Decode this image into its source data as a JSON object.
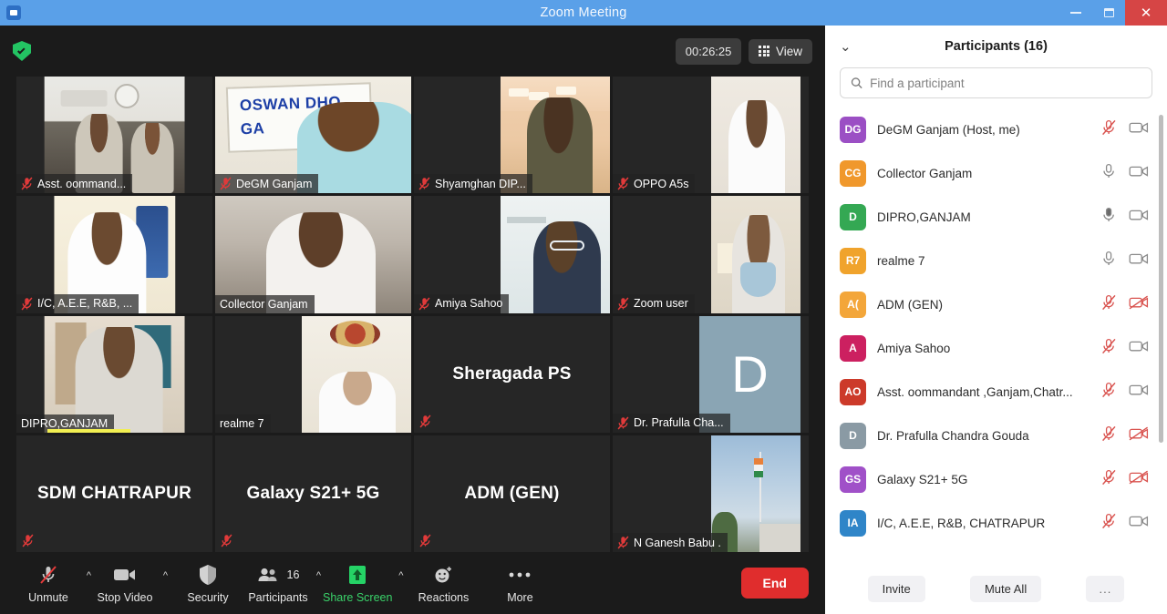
{
  "window": {
    "title": "Zoom Meeting",
    "minimize_label": "Minimize",
    "maximize_label": "Maximize",
    "close_label": "Close"
  },
  "header": {
    "timer": "00:26:25",
    "view_label": "View",
    "encryption_tooltip": "Encryption"
  },
  "tiles": [
    {
      "name": "Asst. oommand...",
      "muted": true,
      "kind": "video",
      "scene": "sc1",
      "frame": "w-center72",
      "label_style": "bar"
    },
    {
      "name": "DeGM Ganjam",
      "muted": true,
      "kind": "video",
      "scene": "sc2",
      "frame": "w-full",
      "label_style": "bar"
    },
    {
      "name": "Shyamghan DIP...",
      "muted": true,
      "kind": "video",
      "scene": "sc3",
      "frame": "w-rightwide",
      "label_style": "bar"
    },
    {
      "name": "OPPO A5s",
      "muted": true,
      "kind": "video",
      "scene": "sc4",
      "frame": "w-right",
      "label_style": "bar"
    },
    {
      "name": "I/C, A.E.E, R&B, ...",
      "muted": true,
      "kind": "video",
      "scene": "sc5",
      "frame": "w-mid",
      "label_style": "bar"
    },
    {
      "name": "Collector Ganjam",
      "muted": false,
      "kind": "video",
      "scene": "sc6",
      "frame": "w-full",
      "label_style": "bar",
      "active_speaker": true
    },
    {
      "name": "Amiya Sahoo",
      "muted": true,
      "kind": "video",
      "scene": "sc7",
      "frame": "w-rightwide",
      "label_style": "bar"
    },
    {
      "name": "Zoom user",
      "muted": true,
      "kind": "video",
      "scene": "sc8",
      "frame": "w-right",
      "label_style": "bar"
    },
    {
      "name": "DIPRO,GANJAM",
      "muted": false,
      "kind": "video",
      "scene": "sc9",
      "frame": "w-center72",
      "label_style": "bar",
      "speaking_bar": true
    },
    {
      "name": "realme 7",
      "muted": false,
      "kind": "video",
      "scene": "sc10",
      "frame": "w-rightwide",
      "label_style": "bar"
    },
    {
      "name": "Sheragada PS",
      "muted": true,
      "kind": "name",
      "label_style": "center"
    },
    {
      "name": "Dr. Prafulla Cha...",
      "muted": true,
      "kind": "avatar",
      "avatar_letter": "D",
      "label_style": "bar"
    },
    {
      "name": "SDM CHATRAPUR",
      "muted": true,
      "kind": "name",
      "label_style": "center"
    },
    {
      "name": "Galaxy S21+ 5G",
      "muted": true,
      "kind": "name",
      "label_style": "center"
    },
    {
      "name": "ADM (GEN)",
      "muted": true,
      "kind": "name",
      "label_style": "center"
    },
    {
      "name": "N Ganesh Babu .",
      "muted": true,
      "kind": "video",
      "scene": "sc11",
      "frame": "w-right",
      "label_style": "bar"
    }
  ],
  "toolbar": {
    "items": [
      {
        "label": "Unmute",
        "icon": "mic-muted-icon",
        "caret": true,
        "accent": false
      },
      {
        "label": "Stop Video",
        "icon": "video-icon",
        "caret": true,
        "accent": false
      },
      {
        "label": "Security",
        "icon": "shield-icon",
        "caret": false,
        "accent": false
      },
      {
        "label": "Participants",
        "icon": "participants-icon",
        "caret": true,
        "accent": false,
        "badge": "16"
      },
      {
        "label": "Share Screen",
        "icon": "share-screen-icon",
        "caret": true,
        "accent": true
      },
      {
        "label": "Reactions",
        "icon": "reactions-icon",
        "caret": false,
        "accent": false
      },
      {
        "label": "More",
        "icon": "more-icon",
        "caret": false,
        "accent": false
      }
    ],
    "end_label": "End"
  },
  "panel": {
    "title": "Participants (16)",
    "search_placeholder": "Find a participant",
    "search_value": "",
    "participants": [
      {
        "initials": "DG",
        "color": "#9b4fc4",
        "name": "DeGM Ganjam  (Host, me)",
        "mic": "muted",
        "video": "on"
      },
      {
        "initials": "CG",
        "color": "#f0982c",
        "name": "Collector Ganjam",
        "mic": "on",
        "video": "on"
      },
      {
        "initials": "D",
        "color": "#34a853",
        "name": "DIPRO,GANJAM",
        "mic": "active",
        "video": "on"
      },
      {
        "initials": "R7",
        "color": "#f0a32c",
        "name": "realme 7",
        "mic": "on",
        "video": "on"
      },
      {
        "initials": "A(",
        "color": "#f3a63a",
        "name": "ADM (GEN)",
        "mic": "muted",
        "video": "off"
      },
      {
        "initials": "A",
        "color": "#cc2060",
        "name": "Amiya Sahoo",
        "mic": "muted",
        "video": "on"
      },
      {
        "initials": "AO",
        "color": "#cc3a2a",
        "name": "Asst. oommandant ,Ganjam,Chatr...",
        "mic": "muted",
        "video": "on"
      },
      {
        "initials": "D",
        "color": "#8a9aa4",
        "name": "Dr. Prafulla Chandra Gouda",
        "mic": "muted",
        "video": "off"
      },
      {
        "initials": "GS",
        "color": "#a050c8",
        "name": "Galaxy S21+ 5G",
        "mic": "muted",
        "video": "off"
      },
      {
        "initials": "IA",
        "color": "#2f85c8",
        "name": "I/C, A.E.E, R&B, CHATRAPUR",
        "mic": "muted",
        "video": "on"
      }
    ],
    "footer": {
      "invite_label": "Invite",
      "mute_all_label": "Mute All",
      "more_label": "..."
    }
  },
  "colors": {
    "titlebar": "#5aa0e8",
    "accent_green": "#3ad36a",
    "end_red": "#e02d2d",
    "active_speaker": "#e8ef4a"
  }
}
